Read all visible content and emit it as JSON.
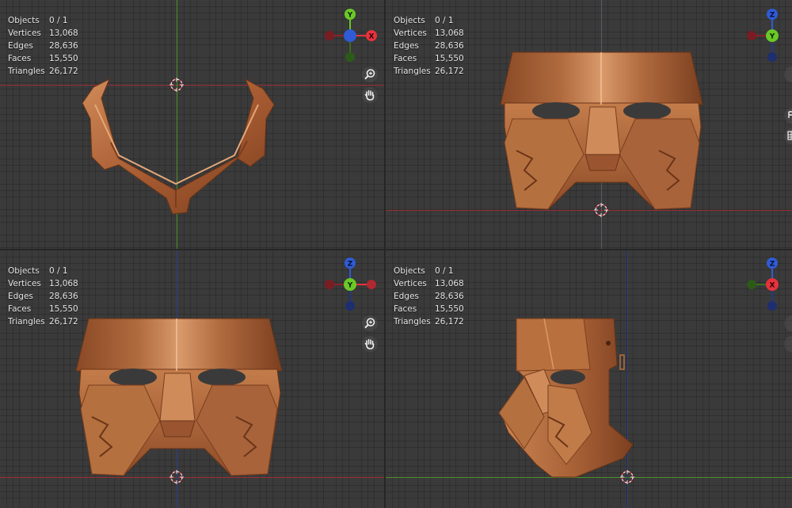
{
  "stats": {
    "objects_label": "Objects",
    "objects_value": "0 / 1",
    "vertices_label": "Vertices",
    "vertices_value": "13,068",
    "edges_label": "Edges",
    "edges_value": "28,636",
    "faces_label": "Faces",
    "faces_value": "15,550",
    "triangles_label": "Triangles",
    "triangles_value": "26,172"
  },
  "viewports": {
    "top_left": {
      "gizmo_up": "Y",
      "gizmo_right": "X"
    },
    "top_right": {
      "gizmo_up": "Z",
      "gizmo_center": "Y"
    },
    "bottom_left": {
      "gizmo_up": "Z",
      "gizmo_center": "Y"
    },
    "bottom_right": {
      "gizmo_up": "Z",
      "gizmo_center": "X"
    }
  },
  "icons": {
    "zoom": "zoom-icon",
    "pan": "hand-pan-icon",
    "cursor": "3d-cursor-icon"
  },
  "colors": {
    "x_axis": "#e8323c",
    "y_axis": "#6ac926",
    "z_axis": "#2f5bd6",
    "model_copper": "#b8693c"
  }
}
